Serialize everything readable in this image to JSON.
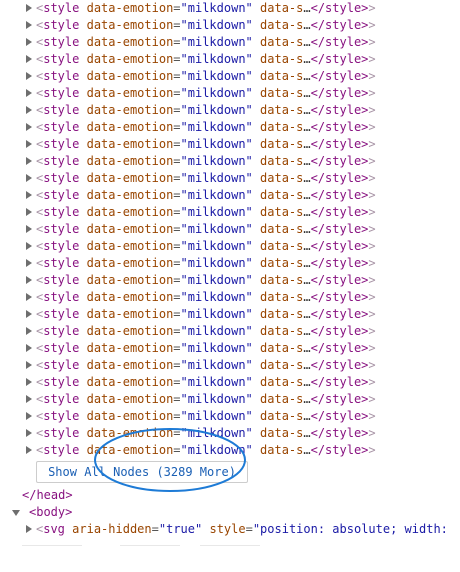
{
  "style_node": {
    "open_lt": "<",
    "tag": "style",
    "attr_name": "data-emotion",
    "eq": "=",
    "attr_value": "\"milkdown\"",
    "attr2_fragment": "data-s",
    "ellipsis": "…",
    "close_tag": "</style>",
    "gt": ">"
  },
  "style_row_count": 27,
  "show_all_button": {
    "label": "Show All Nodes (3289 More)"
  },
  "head_close": {
    "text": "</head>"
  },
  "body_open": {
    "text": "<body>"
  },
  "svg_row": {
    "lt": "<",
    "tag": "svg",
    "attr1_name": "aria-hidden",
    "eq": "=",
    "attr1_value": "\"true\"",
    "attr2_name": "style",
    "attr2_value_fragment": "\"position: absolute; width:"
  },
  "annotation": {
    "color": "#1e7bd6",
    "shape": "ellipse"
  }
}
